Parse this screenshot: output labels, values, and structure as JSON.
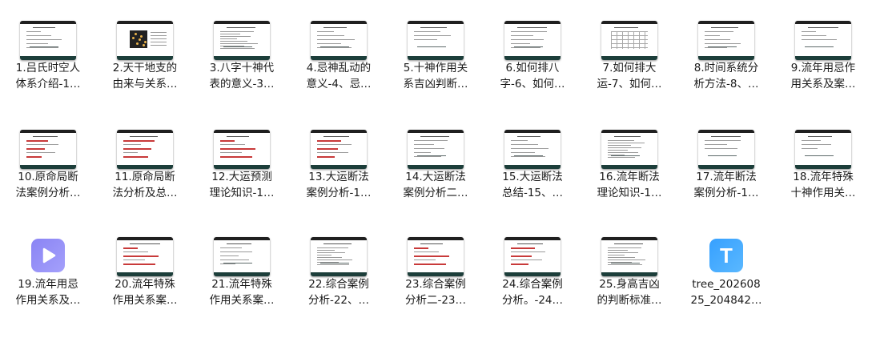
{
  "files": [
    {
      "line1": "1.吕氏时空人",
      "line2": "体系介绍-1…",
      "kind": "slide",
      "style": "text"
    },
    {
      "line1": "2.天干地支的",
      "line2": "由来与关系…",
      "kind": "slide",
      "style": "photo"
    },
    {
      "line1": "3.八字十神代",
      "line2": "表的意义-3…",
      "kind": "slide",
      "style": "dense"
    },
    {
      "line1": "4.忌神乱动的",
      "line2": "意义-4、忌…",
      "kind": "slide",
      "style": "text"
    },
    {
      "line1": "5.十神作用关",
      "line2": "系吉凶判断…",
      "kind": "slide",
      "style": "sparse"
    },
    {
      "line1": "6.如何排八",
      "line2": "字-6、如何…",
      "kind": "slide",
      "style": "text"
    },
    {
      "line1": "7.如何排大",
      "line2": "运-7、如何…",
      "kind": "slide",
      "style": "grid"
    },
    {
      "line1": "8.时间系统分",
      "line2": "析方法-8、…",
      "kind": "slide",
      "style": "text"
    },
    {
      "line1": "9.流年用忌作",
      "line2": "用关系及案…",
      "kind": "slide",
      "style": "sparse"
    },
    {
      "line1": "10.原命局断",
      "line2": "法案例分析…",
      "kind": "slide",
      "style": "red"
    },
    {
      "line1": "11.原命局断",
      "line2": "法分析及总…",
      "kind": "slide",
      "style": "red"
    },
    {
      "line1": "12.大运预测",
      "line2": "理论知识-1…",
      "kind": "slide",
      "style": "red"
    },
    {
      "line1": "13.大运断法",
      "line2": "案例分析-1…",
      "kind": "slide",
      "style": "red"
    },
    {
      "line1": "14.大运断法",
      "line2": "案例分析二…",
      "kind": "slide",
      "style": "text"
    },
    {
      "line1": "15.大运断法",
      "line2": "总结-15、…",
      "kind": "slide",
      "style": "text"
    },
    {
      "line1": "16.流年断法",
      "line2": "理论知识-1…",
      "kind": "slide",
      "style": "dense"
    },
    {
      "line1": "17.流年断法",
      "line2": "案例分析-1…",
      "kind": "slide",
      "style": "sparse"
    },
    {
      "line1": "18.流年特殊",
      "line2": "十神作用关…",
      "kind": "slide",
      "style": "sparse"
    },
    {
      "line1": "19.流年用忌",
      "line2": "作用关系及…",
      "kind": "video",
      "style": ""
    },
    {
      "line1": "20.流年特殊",
      "line2": "作用关系案…",
      "kind": "slide",
      "style": "red"
    },
    {
      "line1": "21.流年特殊",
      "line2": "作用关系案…",
      "kind": "slide",
      "style": "text"
    },
    {
      "line1": "22.综合案例",
      "line2": "分析-22、…",
      "kind": "slide",
      "style": "dense"
    },
    {
      "line1": "23.综合案例",
      "line2": "分析二-23…",
      "kind": "slide",
      "style": "red"
    },
    {
      "line1": "24.综合案例",
      "line2": "分析。-24…",
      "kind": "slide",
      "style": "red"
    },
    {
      "line1": "25.身高吉凶",
      "line2": "的判断标准…",
      "kind": "slide",
      "style": "dense"
    },
    {
      "line1": "tree_202608",
      "line2": "25_204842…",
      "kind": "doc",
      "style": "",
      "icon_letter": "T"
    }
  ],
  "icon_names": {
    "slide": "slide-thumbnail-icon",
    "video": "video-file-icon",
    "doc": "text-document-icon"
  },
  "colors": {
    "video": "#8a84f4",
    "doc": "#36a0ff",
    "slide_footer": "#1c3e3a"
  }
}
